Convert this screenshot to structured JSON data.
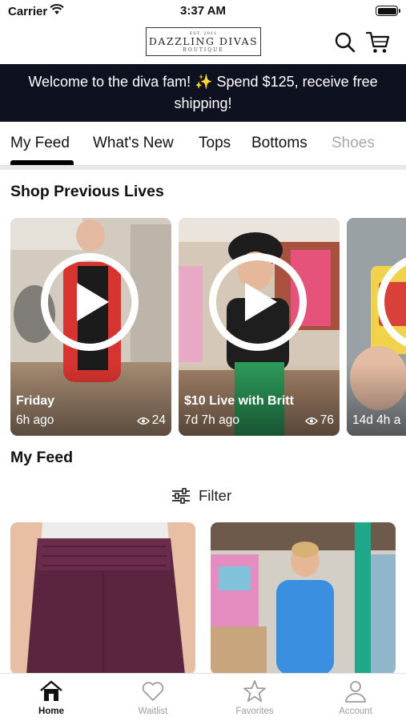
{
  "status_bar": {
    "carrier": "Carrier",
    "time": "3:37 AM"
  },
  "header": {
    "logo": {
      "est": "EST. 2011",
      "name": "DAZZLING DIVAS",
      "sub": "BOUTIQUE"
    }
  },
  "banner": {
    "text": "Welcome to the diva fam! ✨ Spend $125, receive free shipping!"
  },
  "tabs": [
    {
      "label": "My Feed",
      "active": true
    },
    {
      "label": "What's New"
    },
    {
      "label": "Tops"
    },
    {
      "label": "Bottoms"
    },
    {
      "label": "Shoes"
    }
  ],
  "previous_lives": {
    "title": "Shop Previous Lives",
    "cards": [
      {
        "title": "Friday",
        "ago": "6h ago",
        "views": "24"
      },
      {
        "title": "$10 Live with Britt",
        "ago": "7d 7h ago",
        "views": "76"
      },
      {
        "title": "",
        "ago": "14d 4h a",
        "views": ""
      }
    ]
  },
  "feed": {
    "title": "My Feed",
    "filter_label": "Filter"
  },
  "bottom_nav": [
    {
      "label": "Home",
      "icon": "home-icon",
      "active": true
    },
    {
      "label": "Waitlist",
      "icon": "heart-icon"
    },
    {
      "label": "Favorites",
      "icon": "star-icon"
    },
    {
      "label": "Account",
      "icon": "person-icon"
    }
  ],
  "colors": {
    "banner_bg": "#0d1120",
    "active_text": "#111111",
    "inactive_text": "#9c9c9c"
  }
}
